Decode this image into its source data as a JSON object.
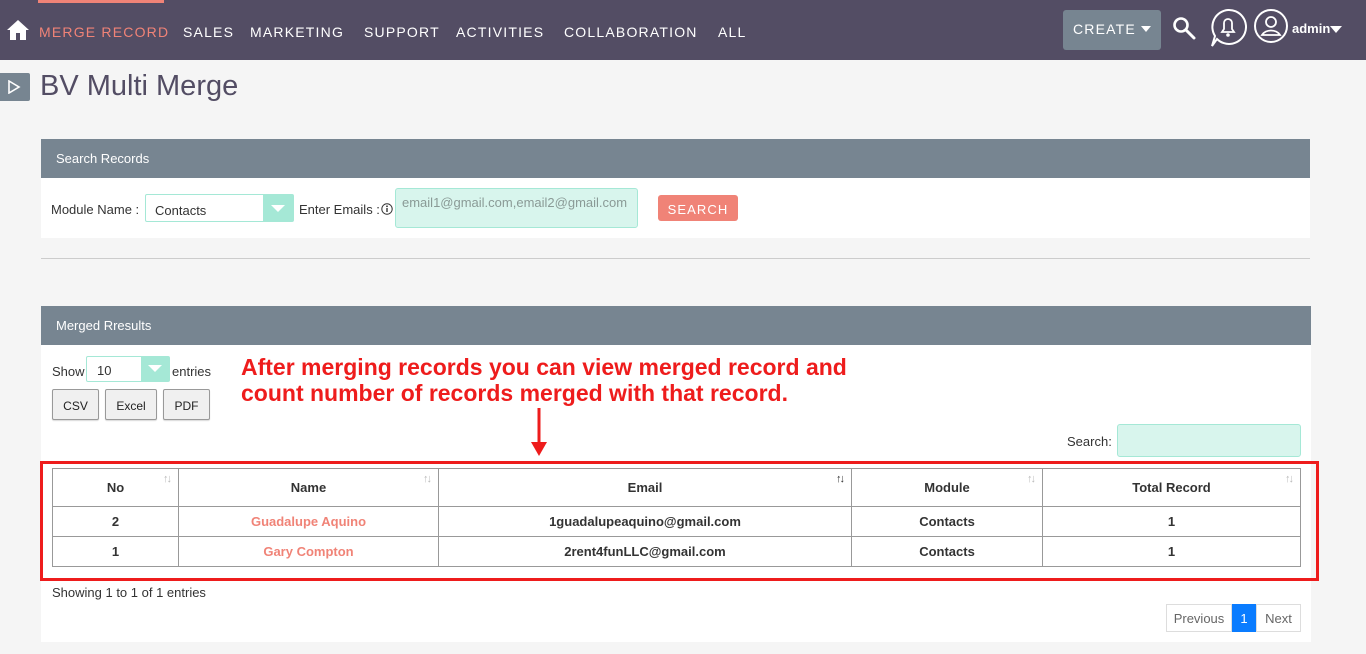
{
  "nav": {
    "items": [
      "MERGE RECORD",
      "SALES",
      "MARKETING",
      "SUPPORT",
      "ACTIVITIES",
      "COLLABORATION",
      "ALL"
    ],
    "active_index": 0,
    "create_label": "CREATE",
    "user_label": "admin"
  },
  "page": {
    "title": "BV Multi Merge"
  },
  "search_panel": {
    "header": "Search Records",
    "module_label": "Module Name :",
    "module_value": "Contacts",
    "emails_label": "Enter Emails :",
    "emails_placeholder": "email1@gmail.com,email2@gmail.com",
    "search_button": "SEARCH"
  },
  "results_panel": {
    "header": "Merged Rresults",
    "show_label": "Show",
    "page_length": "10",
    "entries_label": "entries",
    "export_buttons": [
      "CSV",
      "Excel",
      "PDF"
    ],
    "search_label": "Search:",
    "columns": [
      "No",
      "Name",
      "Email",
      "Module",
      "Total Record"
    ],
    "rows": [
      {
        "no": "2",
        "name": "Guadalupe Aquino",
        "email": "1guadalupeaquino@gmail.com",
        "module": "Contacts",
        "total": "1"
      },
      {
        "no": "1",
        "name": "Gary Compton",
        "email": "2rent4funLLC@gmail.com",
        "module": "Contacts",
        "total": "1"
      }
    ],
    "info": "Showing 1 to 1 of 1 entries",
    "pagination": {
      "previous": "Previous",
      "current": "1",
      "next": "Next"
    }
  },
  "annotation": {
    "line1": "After merging records you can view merged record and",
    "line2": "count number of records merged with that record."
  },
  "colors": {
    "nav_bg": "#534d64",
    "accent": "#f08377",
    "panel_header": "#778591",
    "input_tint": "#d8f5ed",
    "annotation_red": "#ee1c1c",
    "pager_active": "#0a7cff"
  },
  "icons": [
    "home-icon",
    "search-icon",
    "bell-icon",
    "user-icon",
    "info-icon",
    "play-icon",
    "sort-icon",
    "arrow-down-icon"
  ]
}
